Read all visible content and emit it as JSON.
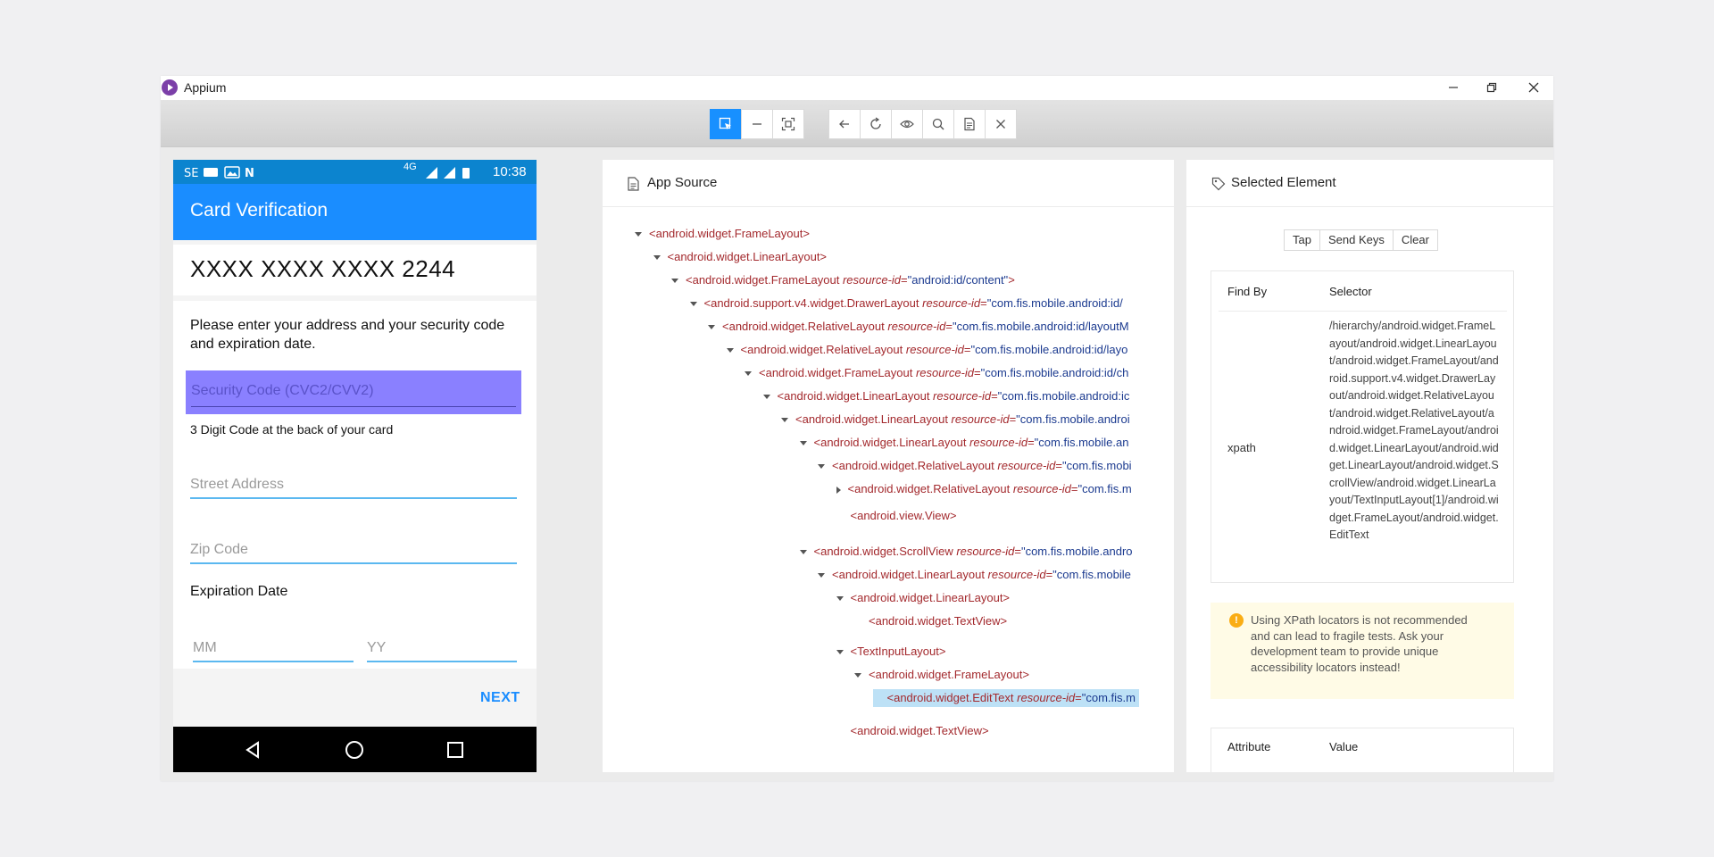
{
  "window": {
    "title": "Appium"
  },
  "device": {
    "status": {
      "network": "4G",
      "time": "10:38"
    },
    "app_title": "Card Verification",
    "card_number": "XXXX XXXX XXXX 2244",
    "instructions": "Please enter your address and your security code and expiration date.",
    "security_code_placeholder": "Security Code (CVC2/CVV2)",
    "security_code_help": "3 Digit Code at the back of your card",
    "street_placeholder": "Street Address",
    "zip_placeholder": "Zip Code",
    "expiration_label": "Expiration Date",
    "month_placeholder": "MM",
    "year_placeholder": "YY",
    "next_label": "NEXT"
  },
  "source_panel": {
    "title": "App Source",
    "nodes": [
      {
        "tag": "<android.widget.FrameLayout>",
        "attr": "",
        "val": "",
        "tail": "",
        "caret": "down"
      },
      {
        "tag": "<android.widget.LinearLayout>",
        "attr": "",
        "val": "",
        "tail": "",
        "caret": "down"
      },
      {
        "tag": "<android.widget.FrameLayout ",
        "attr": "resource-id",
        "val": "\"android:id/content\"",
        "tail": ">",
        "caret": "down"
      },
      {
        "tag": "<android.support.v4.widget.DrawerLayout ",
        "attr": "resource-id",
        "val": "\"com.fis.mobile.android:id/",
        "tail": "",
        "caret": "down"
      },
      {
        "tag": "<android.widget.RelativeLayout ",
        "attr": "resource-id",
        "val": "\"com.fis.mobile.android:id/layoutM",
        "tail": "",
        "caret": "down"
      },
      {
        "tag": "<android.widget.RelativeLayout ",
        "attr": "resource-id",
        "val": "\"com.fis.mobile.android:id/layo",
        "tail": "",
        "caret": "down"
      },
      {
        "tag": "<android.widget.FrameLayout ",
        "attr": "resource-id",
        "val": "\"com.fis.mobile.android:id/ch",
        "tail": "",
        "caret": "down"
      },
      {
        "tag": "<android.widget.LinearLayout ",
        "attr": "resource-id",
        "val": "\"com.fis.mobile.android:ic",
        "tail": "",
        "caret": "down"
      },
      {
        "tag": "<android.widget.LinearLayout ",
        "attr": "resource-id",
        "val": "\"com.fis.mobile.androi",
        "tail": "",
        "caret": "down"
      },
      {
        "tag": "<android.widget.LinearLayout ",
        "attr": "resource-id",
        "val": "\"com.fis.mobile.an",
        "tail": "",
        "caret": "down"
      },
      {
        "tag": "<android.widget.RelativeLayout ",
        "attr": "resource-id",
        "val": "\"com.fis.mobi",
        "tail": "",
        "caret": "down"
      },
      {
        "tag": "<android.widget.RelativeLayout ",
        "attr": "resource-id",
        "val": "\"com.fis.m",
        "tail": "",
        "caret": "right"
      },
      {
        "tag": "<android.view.View>",
        "attr": "",
        "val": "",
        "tail": "",
        "caret": "none"
      },
      {
        "tag": "<android.widget.ScrollView ",
        "attr": "resource-id",
        "val": "\"com.fis.mobile.andro",
        "tail": "",
        "caret": "down"
      },
      {
        "tag": "<android.widget.LinearLayout ",
        "attr": "resource-id",
        "val": "\"com.fis.mobile",
        "tail": "",
        "caret": "down"
      },
      {
        "tag": "<android.widget.LinearLayout>",
        "attr": "",
        "val": "",
        "tail": "",
        "caret": "down"
      },
      {
        "tag": "<android.widget.TextView>",
        "attr": "",
        "val": "",
        "tail": "",
        "caret": "none"
      },
      {
        "tag": "<TextInputLayout>",
        "attr": "",
        "val": "",
        "tail": "",
        "caret": "down"
      },
      {
        "tag": "<android.widget.FrameLayout>",
        "attr": "",
        "val": "",
        "tail": "",
        "caret": "down"
      },
      {
        "tag": "<android.widget.EditText ",
        "attr": "resource-id",
        "val": "\"com.fis.m",
        "tail": "",
        "caret": "none",
        "selected": true
      },
      {
        "tag": "<android.widget.TextView>",
        "attr": "",
        "val": "",
        "tail": "",
        "caret": "none"
      }
    ]
  },
  "selected_panel": {
    "title": "Selected Element",
    "actions": [
      "Tap",
      "Send Keys",
      "Clear"
    ],
    "find_by_header": "Find By",
    "selector_header": "Selector",
    "find_by": "xpath",
    "selector": "/hierarchy/android.widget.FrameLayout/android.widget.LinearLayout/android.widget.FrameLayout/android.support.v4.widget.DrawerLayout/android.widget.RelativeLayout/android.widget.RelativeLayout/android.widget.FrameLayout/android.widget.LinearLayout/android.widget.LinearLayout/android.widget.ScrollView/android.widget.LinearLayout/TextInputLayout[1]/android.widget.FrameLayout/android.widget.EditText",
    "warning": "Using XPath locators is not recommended and can lead to fragile tests. Ask your development team to provide unique accessibility locators instead!",
    "attribute_header": "Attribute",
    "value_header": "Value"
  },
  "colors": {
    "accent": "#1890ff",
    "app_bar": "#1a8dff",
    "highlight": "#8a80ff",
    "warning_bg": "#fffbe6"
  }
}
